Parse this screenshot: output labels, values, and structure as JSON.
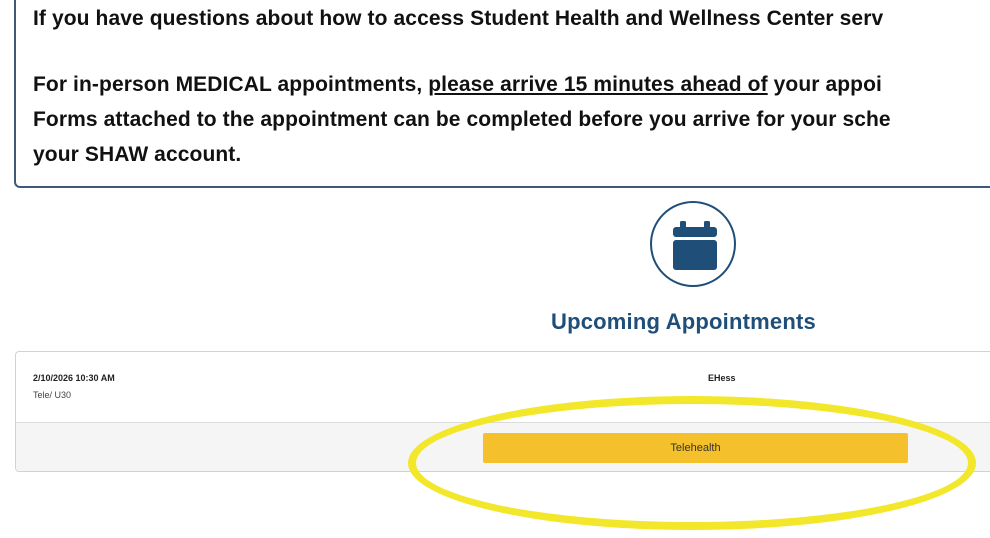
{
  "notice": {
    "line1": "If you have questions about how to access Student Health and Wellness Center serv",
    "line2_prefix": "For in-person MEDICAL appointments, ",
    "line2_underlined": "please arrive 15 minutes ahead of",
    "line2_suffix": " your appoi",
    "line3": "Forms attached to the appointment can be completed before you arrive for your sche",
    "line4": "your SHAW account."
  },
  "upcoming": {
    "icon": "calendar-icon",
    "title": "Upcoming Appointments"
  },
  "appointment": {
    "datetime": "2/10/2026 10:30 AM",
    "type": "Tele/ U30",
    "provider": "EHess",
    "action_label": "Telehealth"
  },
  "colors": {
    "accent": "#1f4e79",
    "button": "#f4c02b",
    "highlight": "#f2e72a"
  }
}
